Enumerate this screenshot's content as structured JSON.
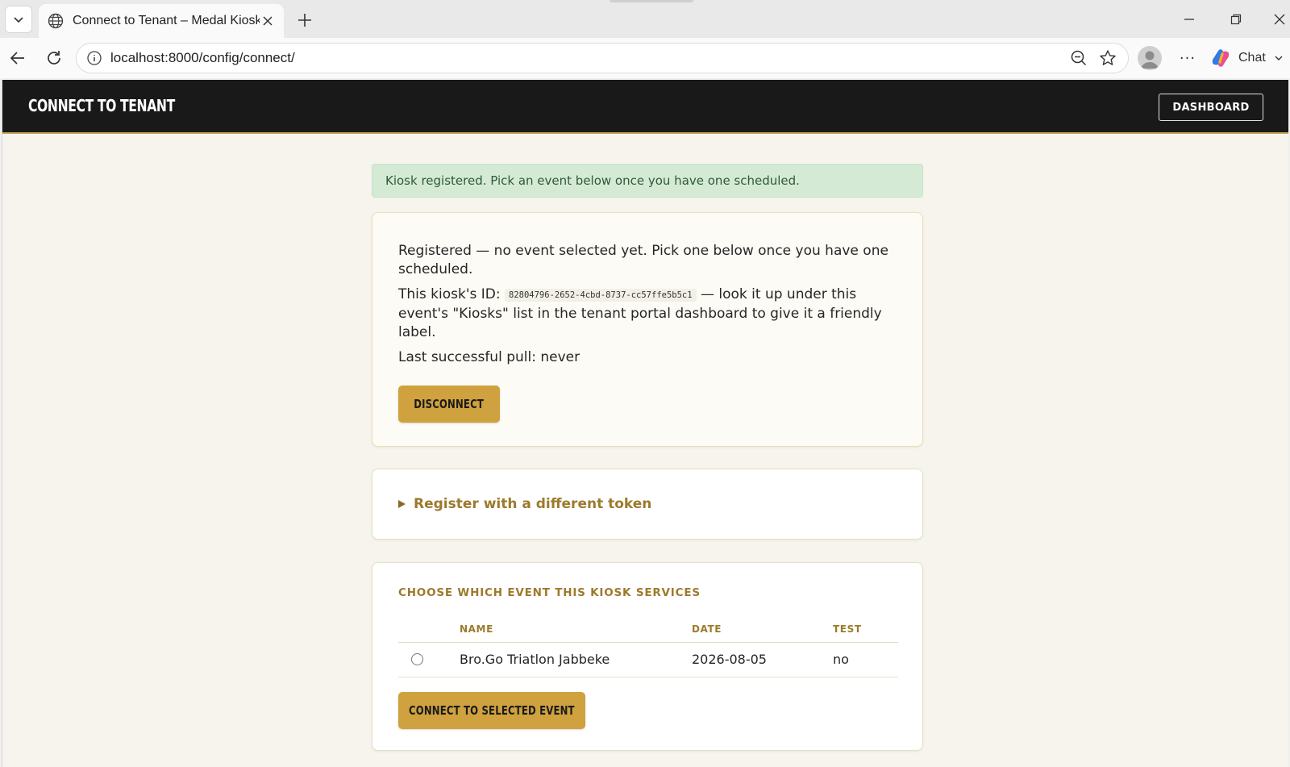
{
  "browser": {
    "tab_title": "Connect to Tenant – Medal Kiosk",
    "url": "localhost:8000/config/connect/",
    "chat_label": "Chat"
  },
  "header": {
    "title": "CONNECT TO TENANT",
    "dashboard_label": "DASHBOARD"
  },
  "alert": {
    "message": "Kiosk registered. Pick an event below once you have one scheduled."
  },
  "status": {
    "line1": "Registered — no event selected yet. Pick one below once you have one scheduled.",
    "kiosk_id_prefix": "This kiosk's ID:",
    "kiosk_id": "82804796-2652-4cbd-8737-cc57ffe5b5c1",
    "kiosk_id_suffix": " — look it up under this event's \"Kiosks\" list in the tenant portal dashboard to give it a friendly label.",
    "last_pull": "Last successful pull: never",
    "disconnect_label": "DISCONNECT"
  },
  "register_other": {
    "summary": "Register with a different token"
  },
  "events": {
    "heading": "CHOOSE WHICH EVENT THIS KIOSK SERVICES",
    "columns": [
      "NAME",
      "DATE",
      "TEST"
    ],
    "rows": [
      {
        "name": "Bro.Go Triatlon Jabbeke",
        "date": "2026-08-05",
        "test": "no"
      }
    ],
    "connect_label": "CONNECT TO SELECTED EVENT"
  },
  "colors": {
    "header_bg": "#191919",
    "accent_gold": "#cfa23f",
    "page_bg": "#f6f4ec",
    "alert_bg": "#d5ead5"
  }
}
